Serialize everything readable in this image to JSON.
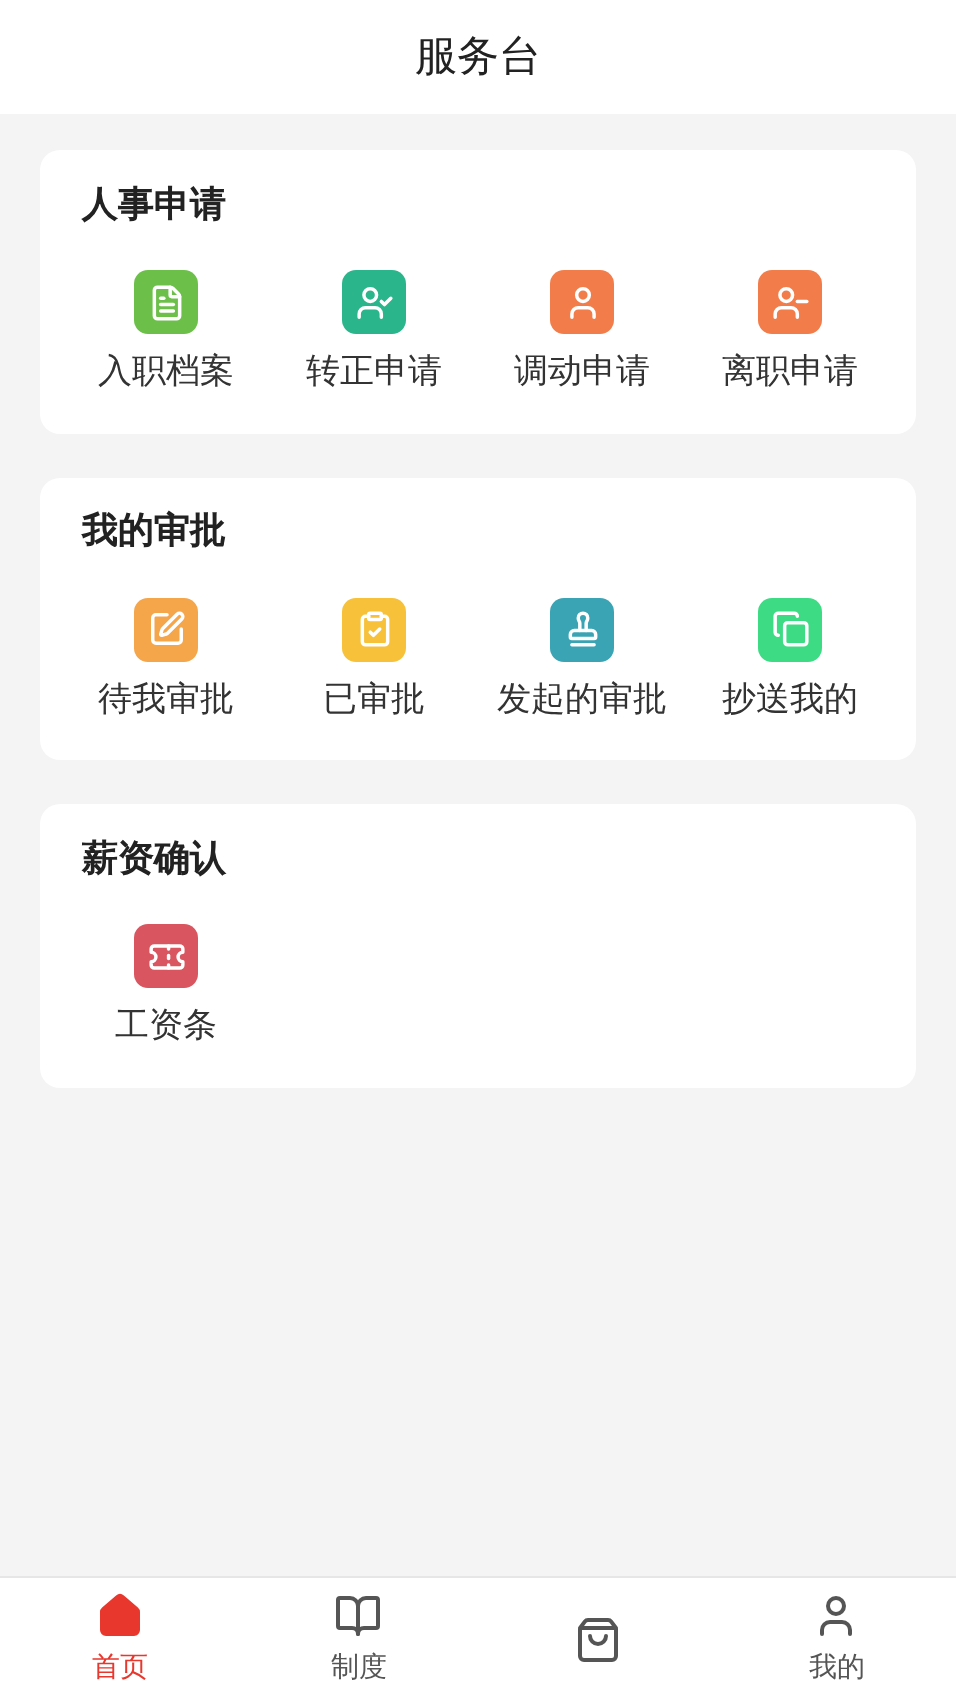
{
  "header": {
    "title": "服务台"
  },
  "sections": [
    {
      "title": "人事申请",
      "items": [
        {
          "label": "入职档案",
          "color": "#6cc04a"
        },
        {
          "label": "转正申请",
          "color": "#2bb58a"
        },
        {
          "label": "调动申请",
          "color": "#f27d4b"
        },
        {
          "label": "离职申请",
          "color": "#f27d4b"
        }
      ]
    },
    {
      "title": "我的审批",
      "items": [
        {
          "label": "待我审批",
          "color": "#f5a54a"
        },
        {
          "label": "已审批",
          "color": "#f7c23a"
        },
        {
          "label": "发起的审批",
          "color": "#3aa4b4"
        },
        {
          "label": "抄送我的",
          "color": "#3ddc84"
        }
      ]
    },
    {
      "title": "薪资确认",
      "items": [
        {
          "label": "工资条",
          "color": "#d9555f"
        }
      ]
    }
  ],
  "tab_bar": [
    {
      "label": "首页",
      "selected": true
    },
    {
      "label": "制度",
      "selected": false
    },
    {
      "selected": false
    },
    {
      "label": "我的",
      "selected": false
    }
  ]
}
